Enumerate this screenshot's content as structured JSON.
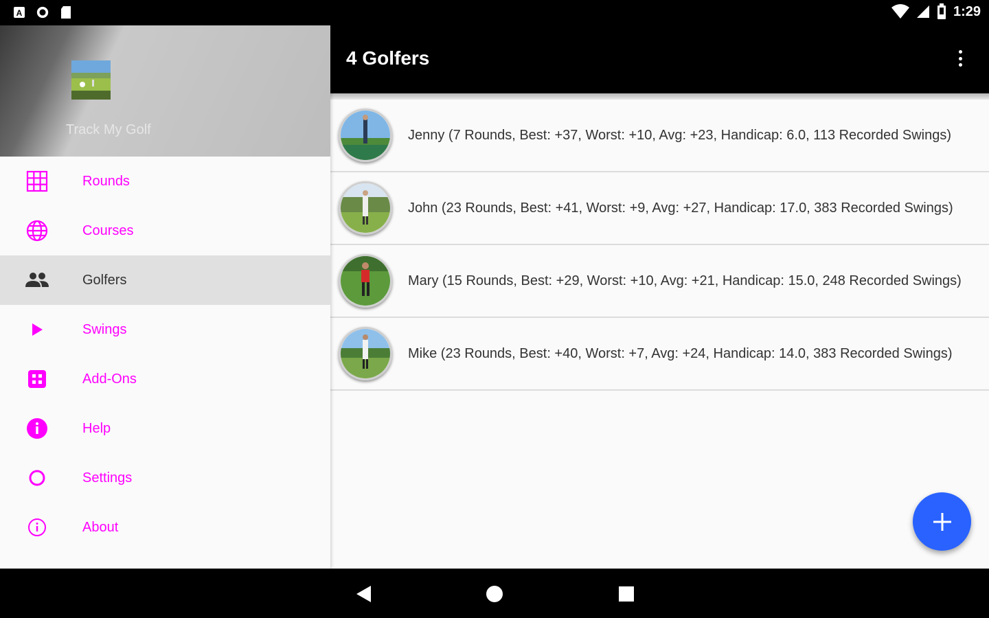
{
  "status_bar": {
    "time": "1:29",
    "left_icons": [
      "a-badge-icon",
      "circle-notification-icon",
      "sd-card-icon"
    ],
    "right_icons": [
      "wifi-icon",
      "cell-signal-icon",
      "battery-icon"
    ]
  },
  "drawer": {
    "app_name": "Track My Golf",
    "items": [
      {
        "label": "Rounds",
        "icon": "grid-icon"
      },
      {
        "label": "Courses",
        "icon": "globe-icon"
      },
      {
        "label": "Golfers",
        "icon": "people-icon",
        "active": true
      },
      {
        "label": "Swings",
        "icon": "play-icon"
      },
      {
        "label": "Add-Ons",
        "icon": "apps-icon"
      },
      {
        "label": "Help",
        "icon": "info-filled-icon"
      },
      {
        "label": "Settings",
        "icon": "settings-ring-icon"
      },
      {
        "label": "About",
        "icon": "info-outline-icon"
      }
    ]
  },
  "app_bar": {
    "title": "4 Golfers",
    "overflow_icon": "more-vert-icon"
  },
  "golfers": [
    {
      "text": "Jenny (7 Rounds, Best: +37, Worst: +10, Avg: +23, Handicap: 6.0, 113 Recorded Swings)"
    },
    {
      "text": "John (23 Rounds, Best: +41, Worst: +9, Avg: +27, Handicap: 17.0, 383 Recorded Swings)"
    },
    {
      "text": "Mary (15 Rounds, Best: +29, Worst: +10, Avg: +21, Handicap: 15.0, 248 Recorded Swings)"
    },
    {
      "text": "Mike (23 Rounds, Best: +40, Worst: +7, Avg: +24, Handicap: 14.0, 383 Recorded Swings)"
    }
  ],
  "fab": {
    "icon": "plus-icon",
    "color": "#2962ff"
  },
  "colors": {
    "accent": "#ff00ff",
    "active_bg": "#e0e0e0",
    "toolbar": "#000000"
  },
  "system_nav": {
    "buttons": [
      "back-icon",
      "home-icon",
      "recents-icon"
    ]
  }
}
